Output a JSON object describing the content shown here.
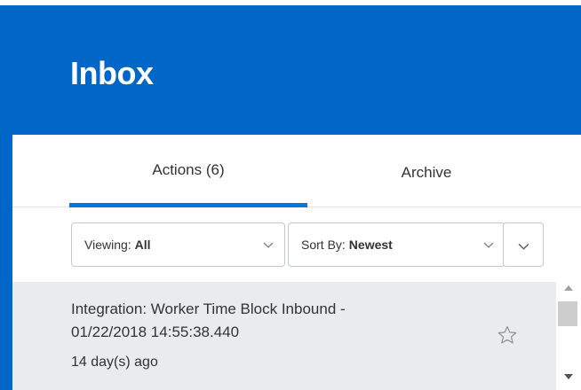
{
  "header": {
    "title": "Inbox",
    "color": "#0066c8"
  },
  "tabs": [
    {
      "label": "Actions (6)",
      "active": true
    },
    {
      "label": "Archive",
      "active": false
    }
  ],
  "toolbar": {
    "viewing": {
      "label": "Viewing:",
      "value": "All"
    },
    "sort": {
      "label": "Sort By:",
      "value": "Newest"
    },
    "expand_icon": "chevron-down-icon"
  },
  "list": {
    "items": [
      {
        "title_line1": "Integration: Worker Time Block Inbound -",
        "title_line2": "01/22/2018 14:55:38.440",
        "time_ago": "14 day(s) ago",
        "icon": "star-outline-icon"
      }
    ]
  },
  "colors": {
    "brand": "#0066c8",
    "tab_underline": "#0875e1",
    "list_bg": "#e9ecef"
  }
}
